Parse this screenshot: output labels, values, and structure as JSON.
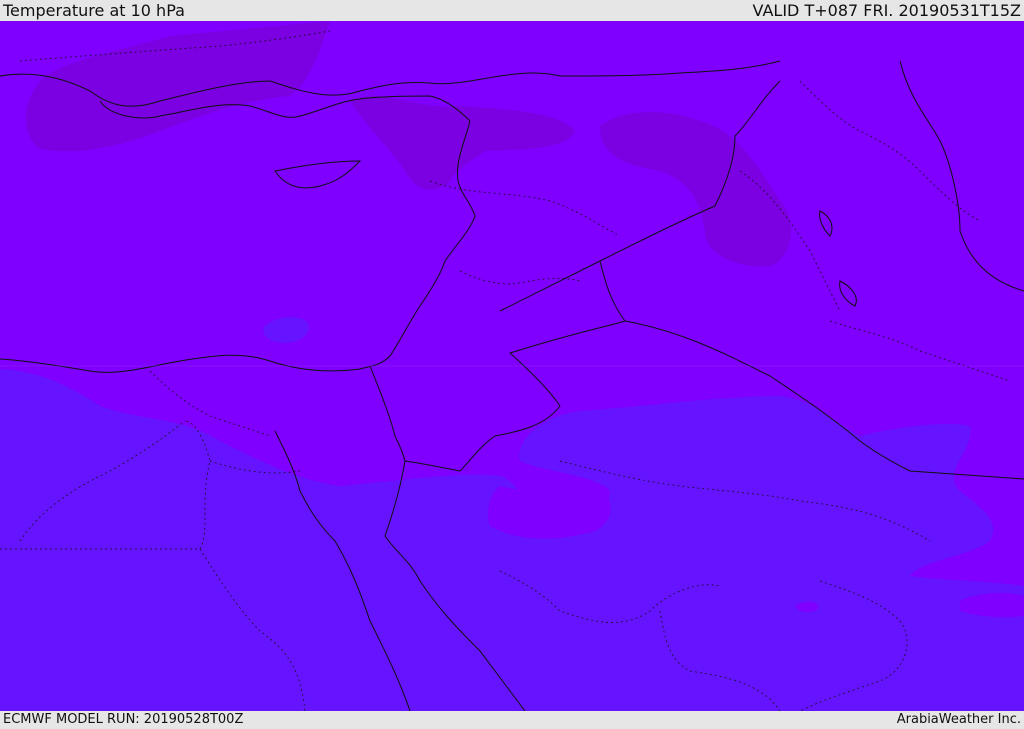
{
  "header": {
    "title": "Temperature at 10 hPa",
    "valid_time": "VALID T+087 FRI. 20190531T15Z"
  },
  "footer": {
    "model_run": "ECMWF MODEL RUN: 20190528T00Z",
    "credit": "ArabiaWeather Inc."
  },
  "colors": {
    "warm_band": "#7f00ff",
    "warmer_patch": "#7a00dd",
    "cool_band": "#6614ff",
    "coast_line": "#111111",
    "border_line": "#111111"
  }
}
